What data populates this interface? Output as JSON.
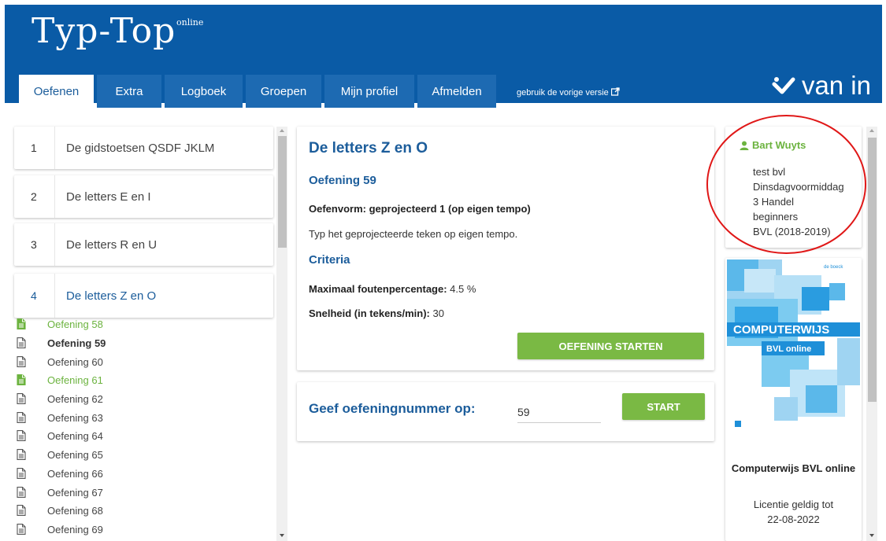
{
  "header": {
    "logo": "Typ-Top",
    "logo_suffix": "online",
    "brand": "van in",
    "old_version_link": "gebruik de vorige versie",
    "tabs": [
      "Oefenen",
      "Extra",
      "Logboek",
      "Groepen",
      "Mijn profiel",
      "Afmelden"
    ],
    "active_tab": "Oefenen"
  },
  "lessons": [
    {
      "number": "1",
      "title": "De gidstoetsen QSDF JKLM"
    },
    {
      "number": "2",
      "title": "De letters E en I"
    },
    {
      "number": "3",
      "title": "De letters R en U"
    },
    {
      "number": "4",
      "title": "De letters Z en O",
      "active": true
    }
  ],
  "exercises": [
    {
      "label": "Oefening 58",
      "status": "done"
    },
    {
      "label": "Oefening 59",
      "status": "current"
    },
    {
      "label": "Oefening 60",
      "status": "todo"
    },
    {
      "label": "Oefening 61",
      "status": "done"
    },
    {
      "label": "Oefening 62",
      "status": "todo"
    },
    {
      "label": "Oefening 63",
      "status": "todo"
    },
    {
      "label": "Oefening 64",
      "status": "todo"
    },
    {
      "label": "Oefening 65",
      "status": "todo"
    },
    {
      "label": "Oefening 66",
      "status": "todo"
    },
    {
      "label": "Oefening 67",
      "status": "todo"
    },
    {
      "label": "Oefening 68",
      "status": "todo"
    },
    {
      "label": "Oefening 69",
      "status": "todo"
    }
  ],
  "detail": {
    "lesson_title": "De letters Z en O",
    "exercise_title": "Oefening 59",
    "oefenvorm": "Oefenvorm: geprojecteerd 1 (op eigen tempo)",
    "description": "Typ het geprojecteerde teken op eigen tempo.",
    "criteria_heading": "Criteria",
    "max_errors_label": "Maximaal foutenpercentage:",
    "max_errors_value": " 4.5 %",
    "speed_label": "Snelheid (in tekens/min):",
    "speed_value": " 30",
    "start_button": "OEFENING STARTEN"
  },
  "goto": {
    "label": "Geef oefeningnummer op:",
    "value": "59",
    "button": "START"
  },
  "user": {
    "name": "Bart Wuyts",
    "lines": [
      "test bvl",
      "Dinsdagvoormiddag",
      "3 Handel",
      "beginners",
      "BVL (2018-2019)"
    ]
  },
  "product": {
    "publisher": "de boeck",
    "cover_title": "COMPUTERWIJS",
    "cover_subtitle": "BVL online",
    "title": "Computerwijs BVL online",
    "license_line1": "Licentie geldig tot",
    "license_line2": "22-08-2022"
  },
  "colors": {
    "header_blue": "#0a5ba6",
    "tab_blue": "#1d6ab2",
    "heading_blue": "#1c5d9b",
    "green": "#7ab944",
    "done_green": "#6cb33f",
    "annotation_red": "#e01717"
  }
}
